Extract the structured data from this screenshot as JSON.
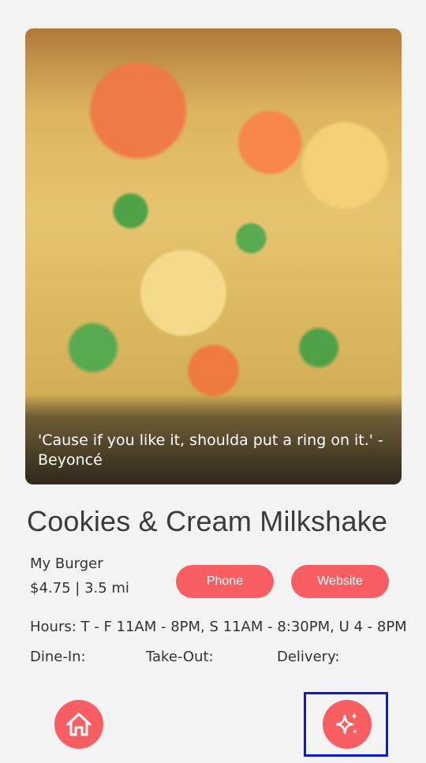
{
  "hero": {
    "quote": "'Cause if you like it, shoulda put a ring on it.' - Beyoncé"
  },
  "item": {
    "name": "Cookies & Cream Milkshake",
    "restaurant": "My Burger",
    "price_distance": "$4.75 | 3.5 mi",
    "hours": "Hours: T - F 11AM - 8PM, S 11AM - 8:30PM, U 4 - 8PM"
  },
  "buttons": {
    "phone_label": "Phone",
    "website_label": "Website"
  },
  "options": {
    "dine_in": "Dine-In:",
    "take_out": "Take-Out:",
    "delivery": "Delivery:"
  },
  "nav": {
    "home_icon": "home-icon",
    "sparkle_icon": "sparkle-icon"
  },
  "colors": {
    "accent": "#f95f62",
    "background": "#f3f3f3",
    "focus_outline": "#0a1ae6"
  }
}
